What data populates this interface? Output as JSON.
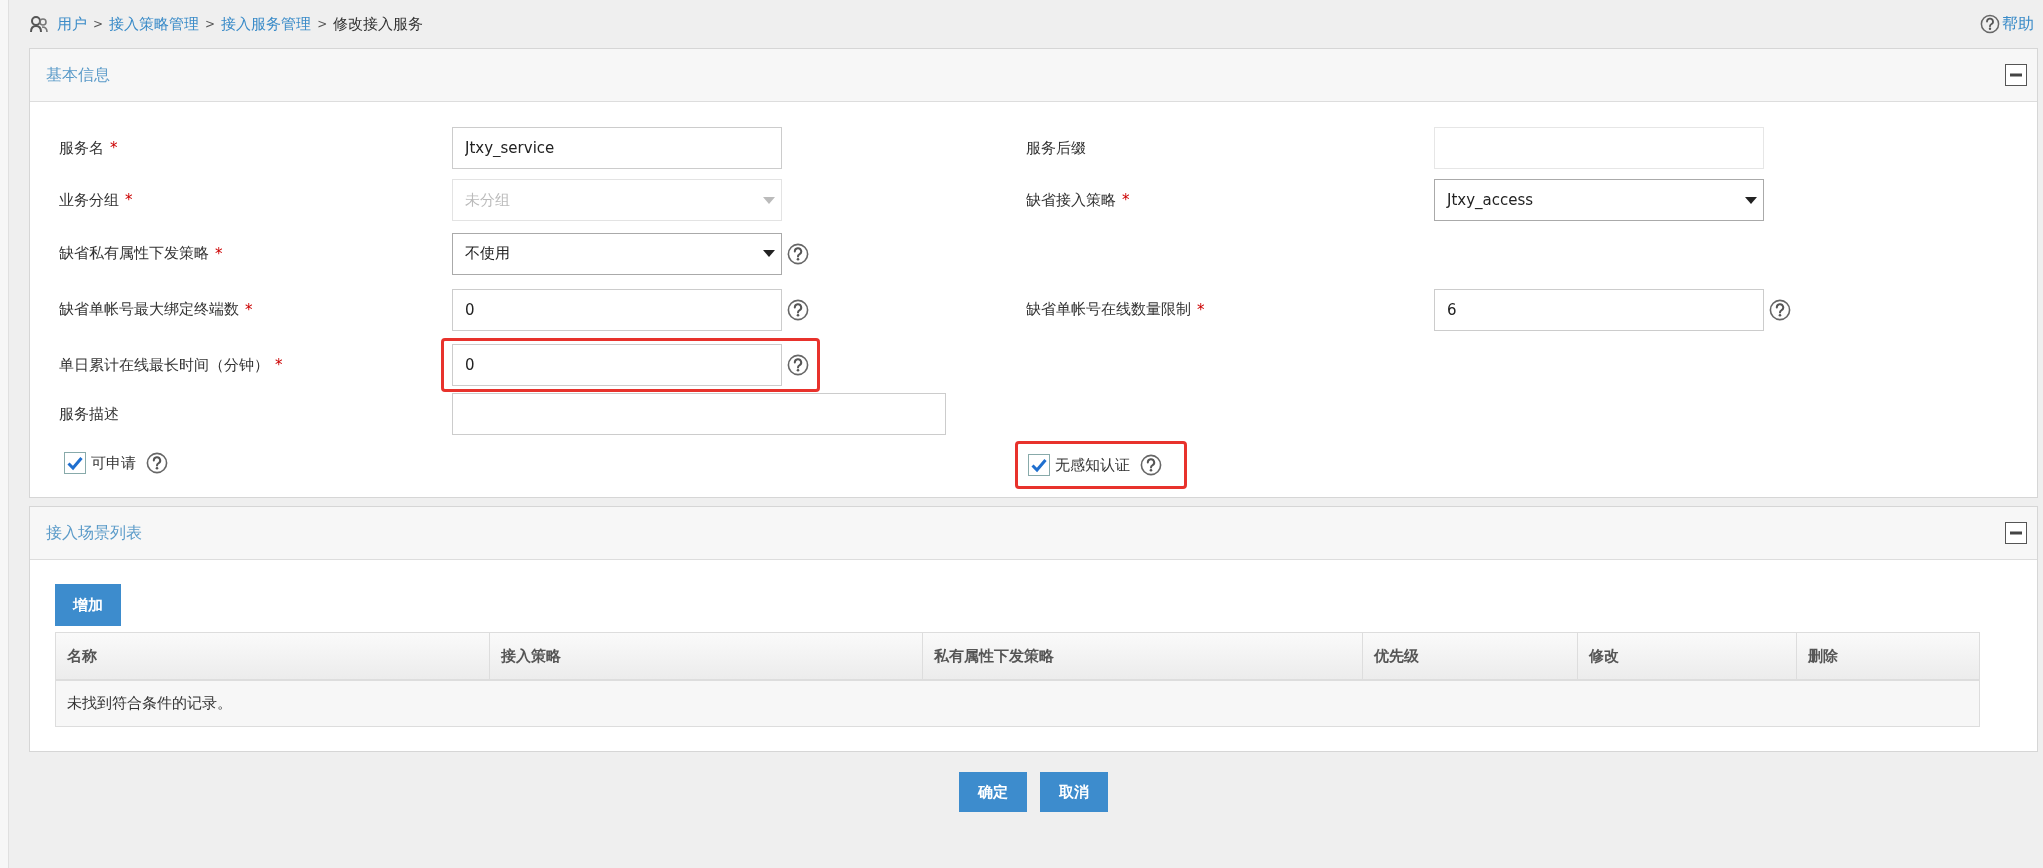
{
  "breadcrumb": [
    {
      "text": "用户",
      "link": true
    },
    {
      "separator": ">",
      "text": "接入策略管理",
      "link": true
    },
    {
      "separator": ">",
      "text": "接入服务管理",
      "link": true
    },
    {
      "separator": ">",
      "text": "修改接入服务",
      "link": false
    }
  ],
  "help_link": "帮助",
  "basic_panel": {
    "title": "基本信息",
    "expanded": true,
    "rows": [
      {
        "left": {
          "kind": "text",
          "label": "服务名",
          "required_mark": "*",
          "value": "Jtxy_service",
          "help": false,
          "highlighted": false
        },
        "right": {
          "kind": "text",
          "label": "服务后缀",
          "help": false,
          "highlighted": false
        }
      },
      {
        "left": {
          "kind": "select",
          "label": "业务分组",
          "required_mark": "*",
          "value": "未分组",
          "disabled": true,
          "help": false,
          "highlighted": false
        },
        "right": {
          "kind": "select",
          "label": "缺省接入策略",
          "required_mark": "*",
          "value": "Jtxy_access",
          "disabled": false,
          "help": false,
          "highlighted": false
        }
      },
      {
        "left": {
          "kind": "select",
          "label": "缺省私有属性下发策略",
          "required_mark": "*",
          "value": "不使用",
          "disabled": false,
          "help": true,
          "highlighted": false
        },
        "right": null
      },
      {
        "left": {
          "kind": "text",
          "label": "缺省单帐号最大绑定终端数",
          "required_mark": "*",
          "value": "0",
          "help": true,
          "highlighted": false
        },
        "right": {
          "kind": "text",
          "label": "缺省单帐号在线数量限制",
          "required_mark": "*",
          "value": "6",
          "help": true,
          "highlighted": false
        }
      },
      {
        "left": {
          "kind": "text",
          "label": "单日累计在线最长时间（分钟）",
          "required_mark": "*",
          "value": "0",
          "help": true,
          "highlighted": true
        },
        "right": null
      },
      {
        "left": {
          "kind": "wide_text",
          "label": "服务描述",
          "help": false,
          "highlighted": false
        },
        "right": null
      },
      {
        "left": {
          "kind": "checkbox",
          "label": "可申请",
          "checked": true,
          "help": true,
          "highlighted": false
        },
        "right": {
          "kind": "checkbox",
          "label": "无感知认证",
          "checked": true,
          "help": true,
          "highlighted": true
        }
      }
    ]
  },
  "scene_panel": {
    "title": "接入场景列表",
    "expanded": true,
    "add_button": "增加",
    "columns": [
      "名称",
      "接入策略",
      "私有属性下发策略",
      "优先级",
      "修改",
      "删除"
    ],
    "empty_text": "未找到符合条件的记录。"
  },
  "buttons": [
    "确定",
    "取消"
  ]
}
